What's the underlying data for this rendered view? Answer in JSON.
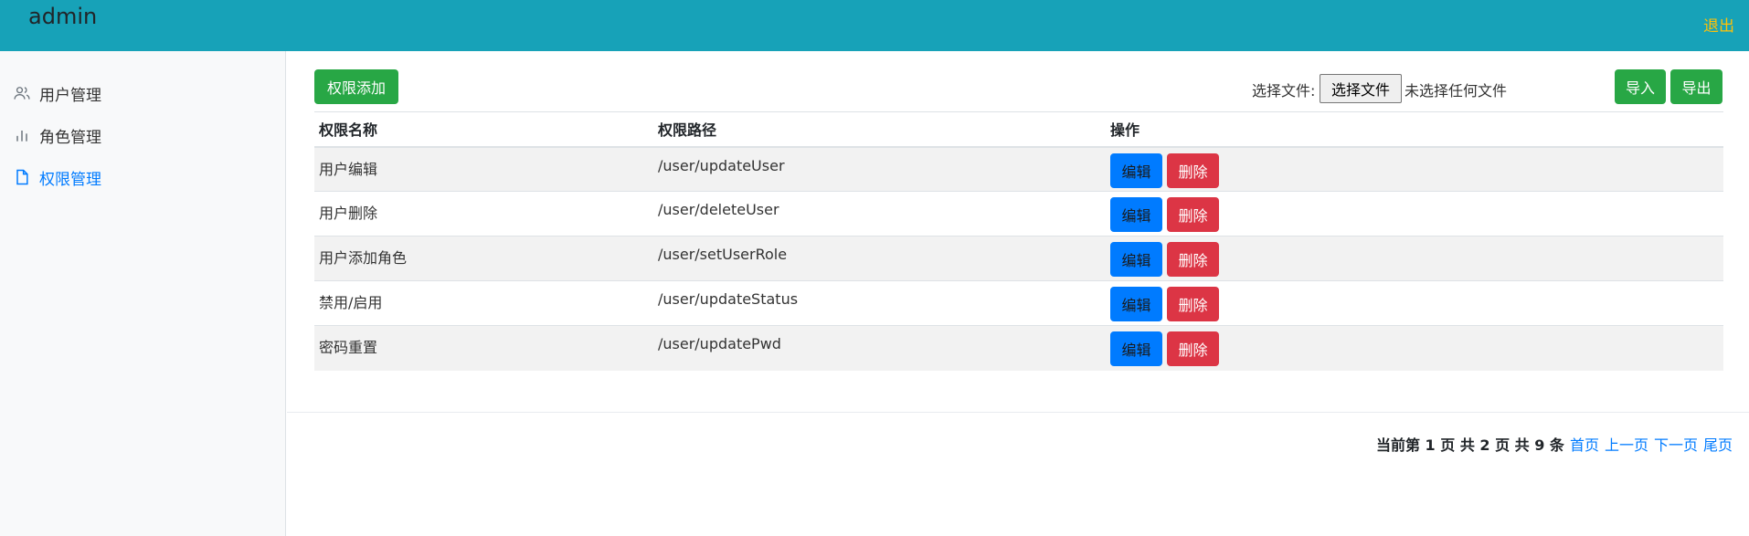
{
  "header": {
    "brand": "admin",
    "logout": "退出"
  },
  "sidebar": {
    "items": [
      {
        "label": "用户管理",
        "icon": "users-icon",
        "active": false
      },
      {
        "label": "角色管理",
        "icon": "bar-chart-icon",
        "active": false
      },
      {
        "label": "权限管理",
        "icon": "file-icon",
        "active": true
      }
    ]
  },
  "toolbar": {
    "add_label": "权限添加",
    "file_label": "选择文件:",
    "file_button": "选择文件",
    "file_status": "未选择任何文件",
    "import_label": "导入",
    "export_label": "导出"
  },
  "table": {
    "headers": [
      "权限名称",
      "权限路径",
      "操作"
    ],
    "rows": [
      {
        "name": "用户编辑",
        "path": "/user/updateUser"
      },
      {
        "name": "用户删除",
        "path": "/user/deleteUser"
      },
      {
        "name": "用户添加角色",
        "path": "/user/setUserRole"
      },
      {
        "name": "禁用/启用",
        "path": "/user/updateStatus"
      },
      {
        "name": "密码重置",
        "path": "/user/updatePwd"
      }
    ],
    "edit_label": "编辑",
    "delete_label": "删除"
  },
  "pager": {
    "info": "当前第 1 页 共 2 页 共 9 条",
    "first": "首页",
    "prev": "上一页",
    "next": "下一页",
    "last": "尾页"
  },
  "colors": {
    "header_bg": "#17a2b8",
    "logout": "#ffc107",
    "success": "#28a745",
    "primary": "#007bff",
    "danger": "#dc3545"
  }
}
